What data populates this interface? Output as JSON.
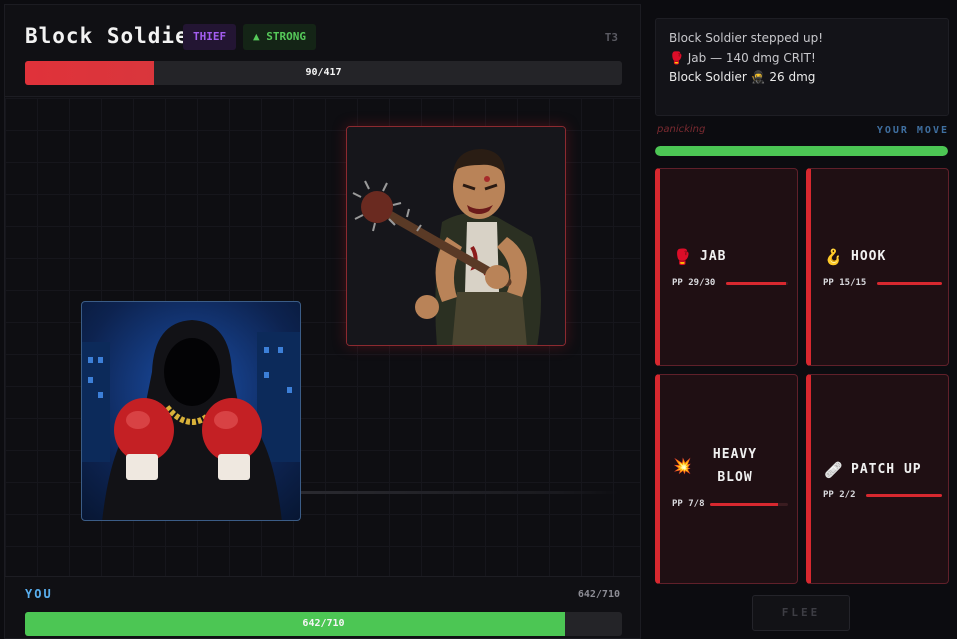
{
  "enemy": {
    "name": "Block Soldier",
    "class_tag": "THIEF",
    "modifier_tag": "▲ STRONG",
    "tier": "T3",
    "hp_text": "90/417",
    "hp_fraction": 0.216,
    "portrait_icon": "zombie-with-spiked-bat"
  },
  "player": {
    "label": "YOU",
    "hp_text": "642/710",
    "hp_bar_text": "642/710",
    "hp_fraction": 0.904,
    "portrait_icon": "hooded-boxer"
  },
  "log": {
    "lines": [
      "Block Soldier stepped up!",
      "🥊 Jab — 140 dmg CRIT!",
      "Block Soldier 🥷 26 dmg"
    ]
  },
  "status": {
    "enemy_state": "panicking",
    "turn": "YOUR MOVE",
    "turn_fraction": 1.0
  },
  "moves": [
    {
      "icon": "🥊",
      "icon_name": "boxing-glove-icon",
      "label": "JAB",
      "pp": "PP 29/30",
      "pp_fraction": 0.967
    },
    {
      "icon": "🪝",
      "icon_name": "hook-icon",
      "label": "HOOK",
      "pp": "PP 15/15",
      "pp_fraction": 1.0
    },
    {
      "icon": "💥",
      "icon_name": "explosion-icon",
      "label": "HEAVY\nBLOW",
      "pp": "PP 7/8",
      "pp_fraction": 0.875
    },
    {
      "icon": "🩹",
      "icon_name": "bandage-icon",
      "label": "PATCH UP",
      "pp": "PP 2/2",
      "pp_fraction": 1.0
    }
  ],
  "flee_label": "FLEE",
  "colors": {
    "enemy_hp": "#e0323a",
    "player_hp": "#4cc654",
    "accent_red": "#d7282f",
    "class_tag": "#a35df0",
    "modifier_tag": "#56c95a",
    "you_label": "#5ab0f0"
  }
}
